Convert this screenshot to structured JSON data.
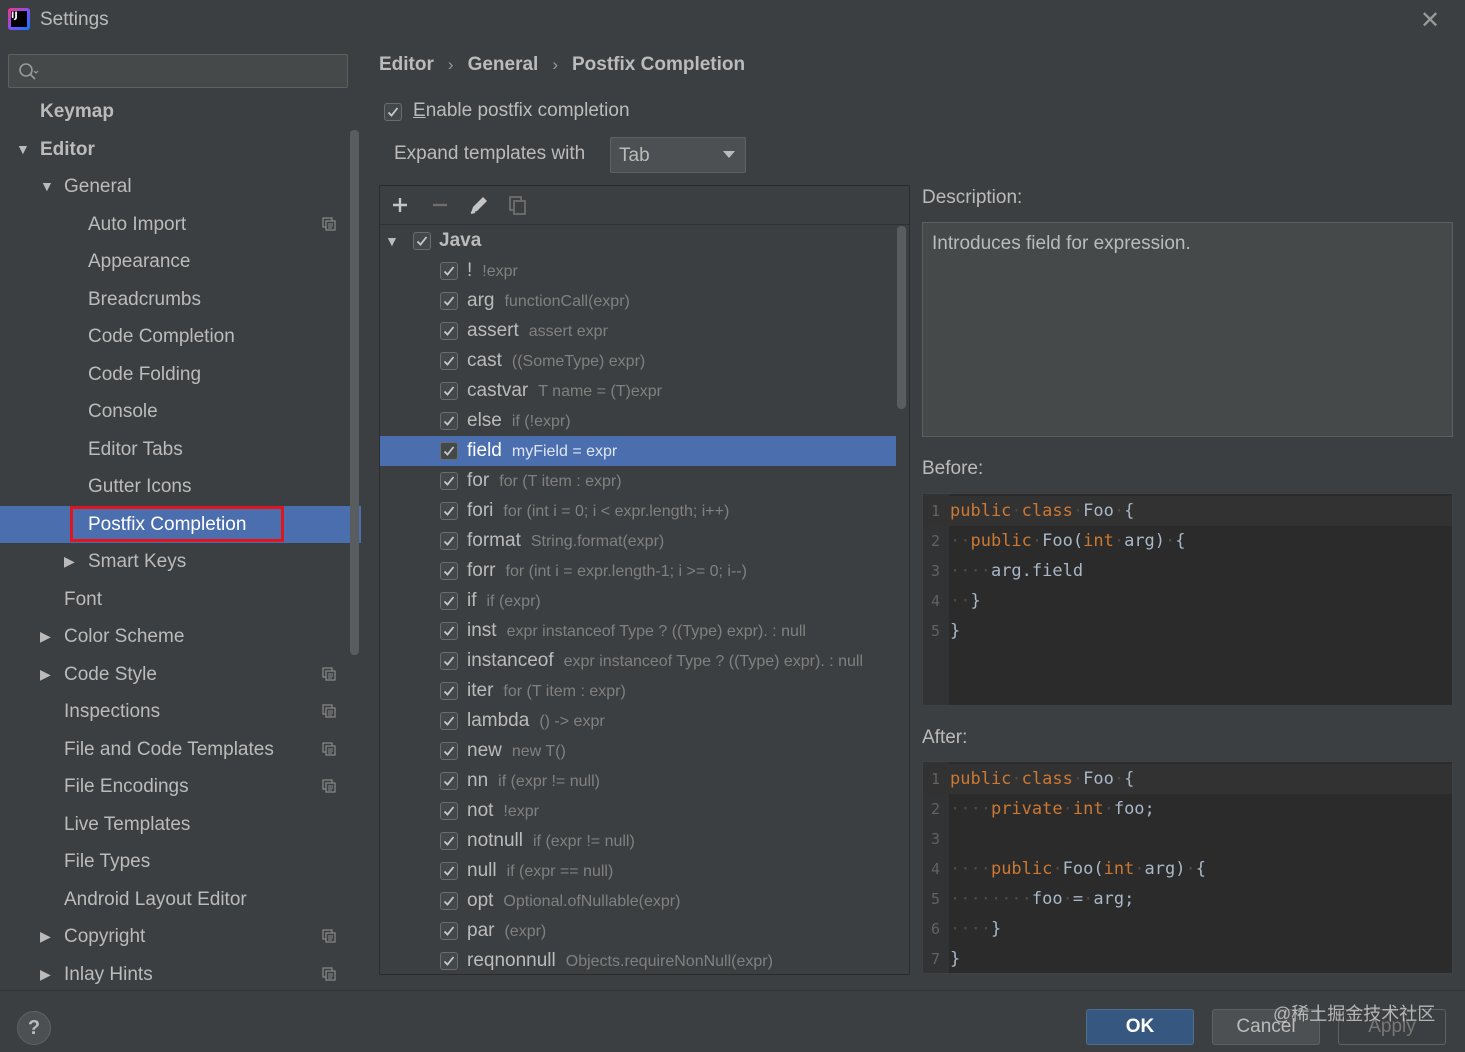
{
  "window": {
    "title": "Settings"
  },
  "search": {
    "placeholder": ""
  },
  "sidebar": {
    "items": [
      {
        "label": "Keymap",
        "bold": true,
        "indent": 40,
        "arrow": "",
        "copy": false
      },
      {
        "label": "Editor",
        "bold": true,
        "indent": 40,
        "arrow": "down",
        "copy": false
      },
      {
        "label": "General",
        "bold": false,
        "indent": 64,
        "arrow": "down",
        "copy": false
      },
      {
        "label": "Auto Import",
        "bold": false,
        "indent": 88,
        "arrow": "",
        "copy": true
      },
      {
        "label": "Appearance",
        "bold": false,
        "indent": 88,
        "arrow": "",
        "copy": false
      },
      {
        "label": "Breadcrumbs",
        "bold": false,
        "indent": 88,
        "arrow": "",
        "copy": false
      },
      {
        "label": "Code Completion",
        "bold": false,
        "indent": 88,
        "arrow": "",
        "copy": false
      },
      {
        "label": "Code Folding",
        "bold": false,
        "indent": 88,
        "arrow": "",
        "copy": false
      },
      {
        "label": "Console",
        "bold": false,
        "indent": 88,
        "arrow": "",
        "copy": false
      },
      {
        "label": "Editor Tabs",
        "bold": false,
        "indent": 88,
        "arrow": "",
        "copy": false
      },
      {
        "label": "Gutter Icons",
        "bold": false,
        "indent": 88,
        "arrow": "",
        "copy": false
      },
      {
        "label": "Postfix Completion",
        "bold": false,
        "indent": 88,
        "arrow": "",
        "copy": false,
        "selected": true
      },
      {
        "label": "Smart Keys",
        "bold": false,
        "indent": 88,
        "arrow": "right",
        "copy": false
      },
      {
        "label": "Font",
        "bold": false,
        "indent": 64,
        "arrow": "",
        "copy": false
      },
      {
        "label": "Color Scheme",
        "bold": false,
        "indent": 64,
        "arrow": "right",
        "copy": false
      },
      {
        "label": "Code Style",
        "bold": false,
        "indent": 64,
        "arrow": "right",
        "copy": true
      },
      {
        "label": "Inspections",
        "bold": false,
        "indent": 64,
        "arrow": "",
        "copy": true
      },
      {
        "label": "File and Code Templates",
        "bold": false,
        "indent": 64,
        "arrow": "",
        "copy": true
      },
      {
        "label": "File Encodings",
        "bold": false,
        "indent": 64,
        "arrow": "",
        "copy": true
      },
      {
        "label": "Live Templates",
        "bold": false,
        "indent": 64,
        "arrow": "",
        "copy": false
      },
      {
        "label": "File Types",
        "bold": false,
        "indent": 64,
        "arrow": "",
        "copy": false
      },
      {
        "label": "Android Layout Editor",
        "bold": false,
        "indent": 64,
        "arrow": "",
        "copy": false
      },
      {
        "label": "Copyright",
        "bold": false,
        "indent": 64,
        "arrow": "right",
        "copy": true
      },
      {
        "label": "Inlay Hints",
        "bold": false,
        "indent": 64,
        "arrow": "right",
        "copy": true
      }
    ]
  },
  "breadcrumb": {
    "items": [
      "Editor",
      "General",
      "Postfix Completion"
    ]
  },
  "options": {
    "enable_label_first": "E",
    "enable_label_rest": "nable postfix completion",
    "enable_checked": true,
    "expand_label": "Expand templates with",
    "expand_value": "Tab"
  },
  "templates": {
    "group": "Java",
    "items": [
      {
        "key": "!",
        "example": "!expr"
      },
      {
        "key": "arg",
        "example": "functionCall(expr)"
      },
      {
        "key": "assert",
        "example": "assert expr"
      },
      {
        "key": "cast",
        "example": "((SomeType) expr)"
      },
      {
        "key": "castvar",
        "example": "T name = (T)expr"
      },
      {
        "key": "else",
        "example": "if (!expr)"
      },
      {
        "key": "field",
        "example": "myField = expr",
        "selected": true
      },
      {
        "key": "for",
        "example": "for (T item : expr)"
      },
      {
        "key": "fori",
        "example": "for (int i = 0; i < expr.length; i++)"
      },
      {
        "key": "format",
        "example": "String.format(expr)"
      },
      {
        "key": "forr",
        "example": "for (int i = expr.length-1; i >= 0; i--)"
      },
      {
        "key": "if",
        "example": "if (expr)"
      },
      {
        "key": "inst",
        "example": "expr instanceof Type ? ((Type) expr). : null"
      },
      {
        "key": "instanceof",
        "example": "expr instanceof Type ? ((Type) expr). : null"
      },
      {
        "key": "iter",
        "example": "for (T item : expr)"
      },
      {
        "key": "lambda",
        "example": "() -> expr"
      },
      {
        "key": "new",
        "example": "new T()"
      },
      {
        "key": "nn",
        "example": "if (expr != null)"
      },
      {
        "key": "not",
        "example": "!expr"
      },
      {
        "key": "notnull",
        "example": "if (expr != null)"
      },
      {
        "key": "null",
        "example": "if (expr == null)"
      },
      {
        "key": "opt",
        "example": "Optional.ofNullable(expr)"
      },
      {
        "key": "par",
        "example": "(expr)"
      },
      {
        "key": "reqnonnull",
        "example": "Objects.requireNonNull(expr)"
      }
    ]
  },
  "description": {
    "label": "Description:",
    "text": "Introduces field for expression."
  },
  "before": {
    "label": "Before:",
    "lines": [
      [
        [
          "kw",
          "public"
        ],
        [
          "ws",
          "·"
        ],
        [
          "kw",
          "class"
        ],
        [
          "ws",
          "·"
        ],
        [
          "t",
          "Foo"
        ],
        [
          "ws",
          "·"
        ],
        [
          "t",
          "{"
        ]
      ],
      [
        [
          "ws",
          "··"
        ],
        [
          "kw",
          "public"
        ],
        [
          "ws",
          "·"
        ],
        [
          "t",
          "Foo("
        ],
        [
          "kw",
          "int"
        ],
        [
          "ws",
          "·"
        ],
        [
          "t",
          "arg)"
        ],
        [
          "ws",
          "·"
        ],
        [
          "t",
          "{"
        ]
      ],
      [
        [
          "ws",
          "····"
        ],
        [
          "t",
          "arg.field"
        ]
      ],
      [
        [
          "ws",
          "··"
        ],
        [
          "t",
          "}"
        ]
      ],
      [
        [
          "t",
          "}"
        ]
      ]
    ]
  },
  "after": {
    "label": "After:",
    "lines": [
      [
        [
          "kw",
          "public"
        ],
        [
          "ws",
          "·"
        ],
        [
          "kw",
          "class"
        ],
        [
          "ws",
          "·"
        ],
        [
          "t",
          "Foo"
        ],
        [
          "ws",
          "·"
        ],
        [
          "t",
          "{"
        ]
      ],
      [
        [
          "ws",
          "····"
        ],
        [
          "kw",
          "private"
        ],
        [
          "ws",
          "·"
        ],
        [
          "kw",
          "int"
        ],
        [
          "ws",
          "·"
        ],
        [
          "t",
          "foo;"
        ]
      ],
      [],
      [
        [
          "ws",
          "····"
        ],
        [
          "kw",
          "public"
        ],
        [
          "ws",
          "·"
        ],
        [
          "t",
          "Foo("
        ],
        [
          "kw",
          "int"
        ],
        [
          "ws",
          "·"
        ],
        [
          "t",
          "arg)"
        ],
        [
          "ws",
          "·"
        ],
        [
          "t",
          "{"
        ]
      ],
      [
        [
          "ws",
          "········"
        ],
        [
          "t",
          "foo"
        ],
        [
          "ws",
          "·"
        ],
        [
          "t",
          "="
        ],
        [
          "ws",
          "·"
        ],
        [
          "t",
          "arg;"
        ]
      ],
      [
        [
          "ws",
          "····"
        ],
        [
          "t",
          "}"
        ]
      ],
      [
        [
          "t",
          "}"
        ]
      ]
    ]
  },
  "buttons": {
    "ok": "OK",
    "cancel": "Cancel",
    "apply": "Apply",
    "help": "?"
  },
  "watermark": "@稀土掘金技术社区",
  "colors": {
    "accent": "#4b6eaf",
    "highlight": "#e0161e",
    "keyword": "#cc7832"
  }
}
